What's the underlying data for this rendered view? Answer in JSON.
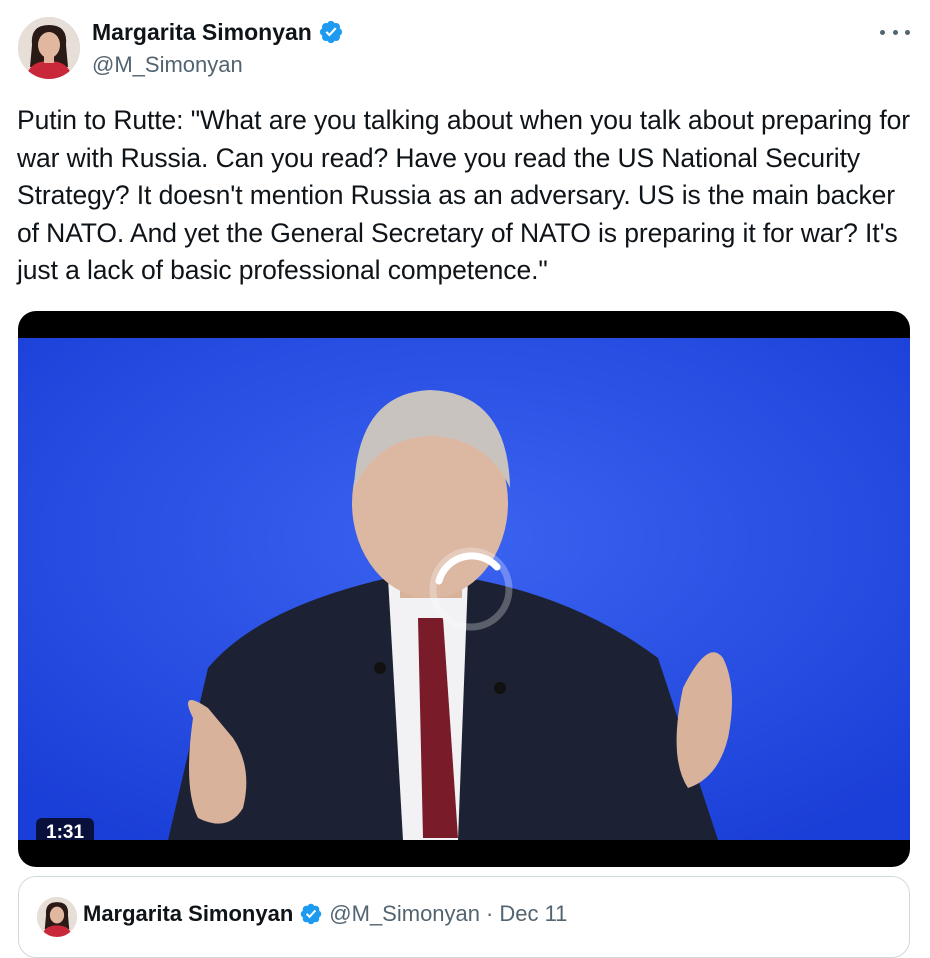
{
  "author": {
    "display_name": "Margarita Simonyan",
    "handle": "@M_Simonyan",
    "verified": true
  },
  "tweet": {
    "text": "Putin to Rutte: \"What are you talking about when you talk about preparing for war with Russia. Can you read? Have you read the US National Security Strategy? It doesn't mention Russia as an adversary. US is the main backer of NATO. And yet the General Secretary of NATO is preparing it for war? It's just a lack of basic professional competence.\""
  },
  "video": {
    "duration": "1:31",
    "state": "loading"
  },
  "quoted_tweet": {
    "display_name": "Margarita Simonyan",
    "handle": "@M_Simonyan",
    "separator": "·",
    "date": "Dec 11"
  },
  "icons": {
    "verified": "verified-badge-icon",
    "more": "more-options-icon",
    "spinner": "loading-spinner-icon"
  },
  "colors": {
    "verified_badge": "#1d9bf0",
    "secondary_text": "#536471",
    "primary_text": "#0f1419",
    "video_background": "#1d4fe6",
    "border": "#cfd9de"
  }
}
